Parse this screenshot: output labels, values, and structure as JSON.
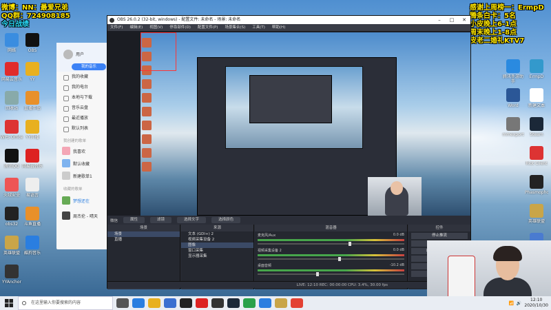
{
  "overlays": {
    "left": [
      "微博：NN：最爱兄弟",
      "QQ群：724908185",
      "今日战绩"
    ],
    "right": [
      "感谢上周榜一：ErmpD",
      "腾条白卡：5名",
      "小皮晚上6-1点",
      "周末晚上1-8点",
      "皮老二婚礼KTV7"
    ]
  },
  "desktop_left_icons": [
    {
      "label": "网络",
      "color": "#3a8de0"
    },
    {
      "label": "网易云音乐",
      "color": "#e02b2b"
    },
    {
      "label": "回收站",
      "color": "#8aa"
    },
    {
      "label": "WPS Office",
      "color": "#d33"
    },
    {
      "label": "腾讯QQ",
      "color": "#111"
    },
    {
      "label": "火绒安全",
      "color": "#e55"
    },
    {
      "label": "obs32",
      "color": "#222"
    },
    {
      "label": "英雄联盟",
      "color": "#c9a548"
    },
    {
      "label": "YYAnchor",
      "color": "#333"
    },
    {
      "label": "OBS",
      "color": "#111"
    },
    {
      "label": "YY",
      "color": "#e8b020"
    },
    {
      "label": "直播伴侣",
      "color": "#e8902a"
    },
    {
      "label": "YY开播",
      "color": "#e8b020"
    },
    {
      "label": "网易云音乐",
      "color": "#d22"
    },
    {
      "label": "易语言",
      "color": "#eee"
    },
    {
      "label": "斗鱼直播",
      "color": "#e8902a"
    },
    {
      "label": "酷狗音乐",
      "color": "#2a7ee0"
    }
  ],
  "desktop_right_icons": [
    {
      "label": "ErmpD",
      "color": "#39c"
    },
    {
      "label": "新建文本",
      "color": "#fff"
    },
    {
      "label": "Steam",
      "color": "#1b2838"
    },
    {
      "label": "Riot Client",
      "color": "#d33"
    },
    {
      "label": "Phasmophobia",
      "color": "#222"
    },
    {
      "label": "英雄联盟",
      "color": "#c9a548"
    },
    {
      "label": "LeagueClient",
      "color": "#4a7bd0"
    },
    {
      "label": "腾讯手游助手",
      "color": "#2a8ae0"
    },
    {
      "label": "Word",
      "color": "#2b5797"
    },
    {
      "label": "mmexport",
      "color": "#777"
    }
  ],
  "music_app": {
    "user": "用户",
    "btn": "我的音乐",
    "menu": [
      "我的收藏",
      "我的电台",
      "本地与下载",
      "音乐云盘",
      "最近播放",
      "默认列表"
    ],
    "section_created": "我创建的歌单",
    "playlists": [
      "我喜欢",
      "默认收藏",
      "新建歌单1"
    ],
    "section_collected": "收藏的歌单",
    "now_playing_title": "梦想还在",
    "now_playing_artist": "周杰伦 - 晴天"
  },
  "obs": {
    "title": "OBS 26.0.2 (32-bit, windows) - 配置文件: 未命名 - 场景: 未命名",
    "menu": [
      "文件(F)",
      "编辑(E)",
      "视图(V)",
      "停靠部件(D)",
      "配置文件(P)",
      "场景集合(S)",
      "工具(T)",
      "帮助(H)"
    ],
    "source_bar": {
      "label": "微信",
      "props": "属性",
      "filters": "滤镜",
      "scene_text": "选择文字",
      "dup": "选择颜色"
    },
    "scenes": {
      "header": "场景",
      "items": [
        "场景",
        "直播"
      ]
    },
    "sources": {
      "header": "来源",
      "items": [
        "文本 (GDI+) 2",
        "视频采集设备 2",
        "图像",
        "窗口采集",
        "显示器采集"
      ]
    },
    "mixer": {
      "header": "混音器",
      "channels": [
        {
          "name": "麦克风/Aux",
          "db": "0.0 dB",
          "level": 0.62
        },
        {
          "name": "视频采集设备 2",
          "db": "0.0 dB",
          "level": 0.55
        },
        {
          "name": "桌面音频",
          "db": "-10.2 dB",
          "level": 0.4
        }
      ]
    },
    "controls": {
      "header": "控件",
      "buttons": [
        "停止推流",
        "开始录制",
        "启动虚拟摄像机",
        "工作室模式",
        "设置",
        "退出"
      ]
    },
    "status": "LIVE: 12:10  REC: 00:00:00  CPU: 3.4%, 30.00 fps"
  },
  "taskbar": {
    "search_placeholder": "在这里输入你要搜索的内容",
    "icons": [
      "task-view",
      "edge",
      "explorer",
      "store",
      "obs",
      "netease",
      "qq",
      "steam",
      "wechat",
      "kugou",
      "league",
      "chrome"
    ],
    "time": "12:10",
    "date": "2020/10/30"
  }
}
